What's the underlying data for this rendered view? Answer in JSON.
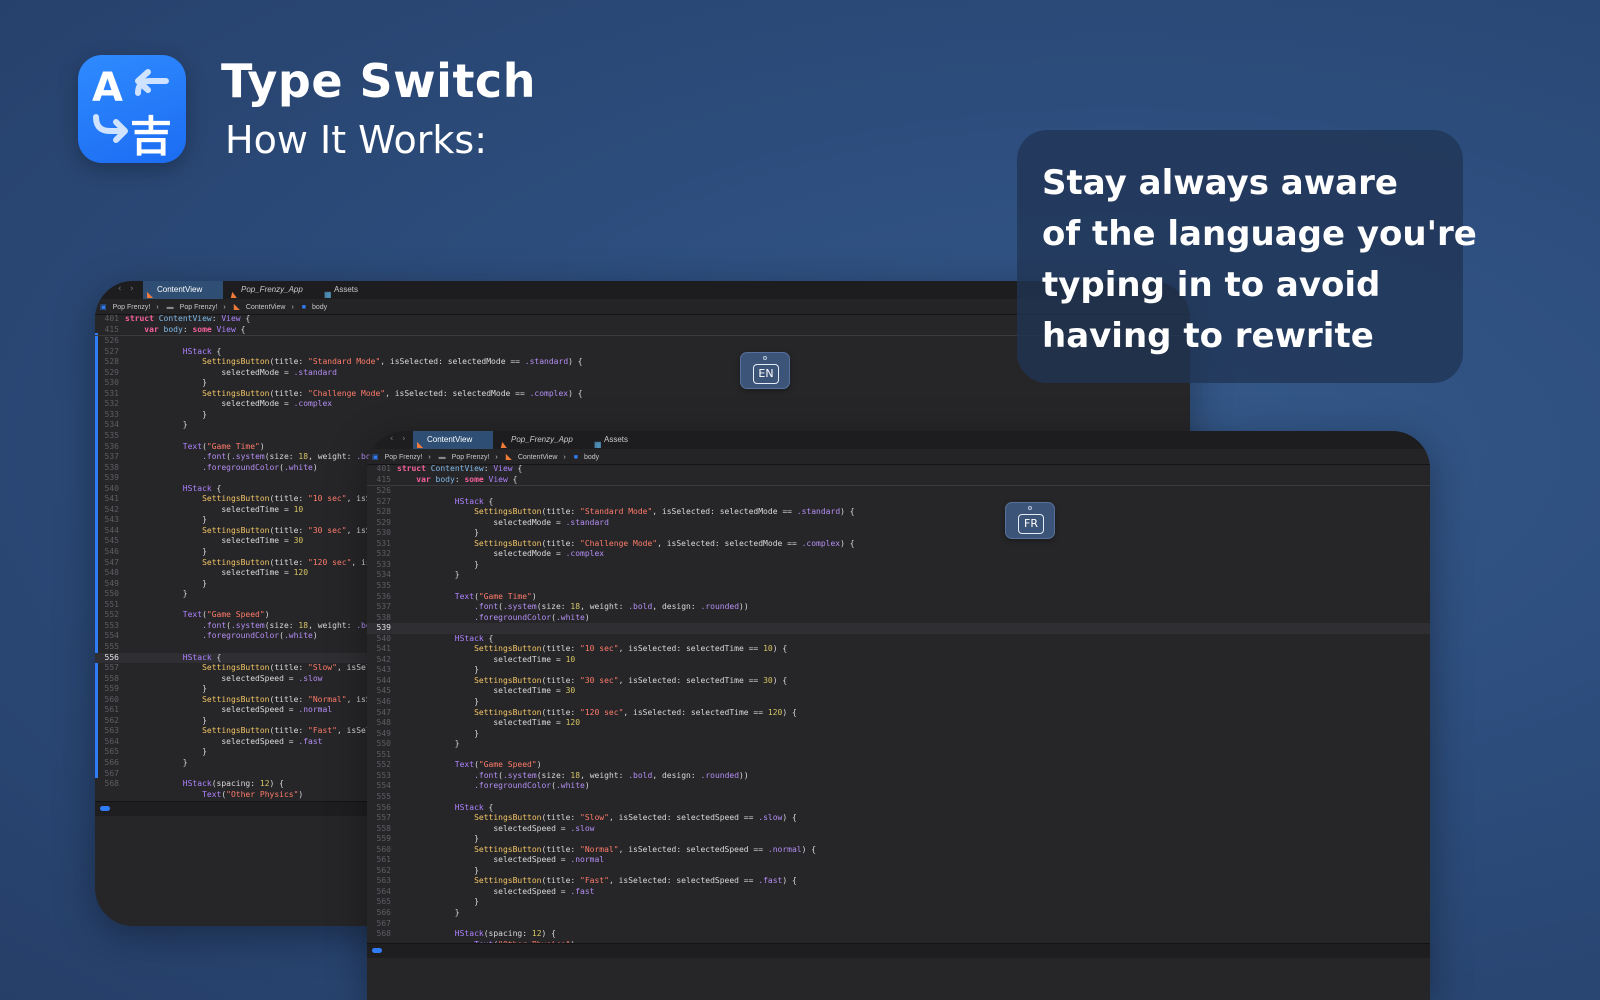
{
  "app": {
    "title": "Type Switch",
    "subtitle": "How It Works:",
    "icon": "translate-icon"
  },
  "callout": {
    "lines": [
      "Stay always aware",
      "of the language you're",
      "typing in to avoid",
      "having to rewrite"
    ]
  },
  "badges": {
    "back": "EN",
    "front": "FR"
  },
  "editor": {
    "tabs": [
      "ContentView",
      "Pop_Frenzy_App",
      "Assets"
    ],
    "breadcrumbs": [
      "Pop Frenzy!",
      "Pop Frenzy!",
      "ContentView",
      "body"
    ],
    "header_lines": [
      {
        "num": "401",
        "html": "<span class=\"kw\">struct</span> <span class=\"fn\">ContentView</span><span class=\"pl\">: </span><span class=\"ty\">View</span><span class=\"pl\"> {</span>"
      },
      {
        "num": "415",
        "html": "    <span class=\"kw\">var</span> <span class=\"fn\">body</span><span class=\"pl\">: </span><span class=\"kw\">some</span> <span class=\"ty\">View</span><span class=\"pl\"> {</span>"
      }
    ],
    "lines": [
      {
        "num": "526",
        "html": ""
      },
      {
        "num": "527",
        "html": "            <span class=\"ty\">HStack</span><span class=\"pl\"> {</span>"
      },
      {
        "num": "528",
        "html": "                <span class=\"cl\">SettingsButton</span><span class=\"pl\">(title: </span><span class=\"st\">\"Standard Mode\"</span><span class=\"pl\">, isSelected: selectedMode == </span><span class=\"pr\">.standard</span><span class=\"pl\">) {</span>"
      },
      {
        "num": "529",
        "html": "                    <span class=\"pl\">selectedMode = </span><span class=\"pr\">.standard</span>"
      },
      {
        "num": "530",
        "html": "                <span class=\"pl\">}</span>"
      },
      {
        "num": "531",
        "html": "                <span class=\"cl\">SettingsButton</span><span class=\"pl\">(title: </span><span class=\"st\">\"Challenge Mode\"</span><span class=\"pl\">, isSelected: selectedMode == </span><span class=\"pr\">.complex</span><span class=\"pl\">) {</span>"
      },
      {
        "num": "532",
        "html": "                    <span class=\"pl\">selectedMode = </span><span class=\"pr\">.complex</span>"
      },
      {
        "num": "533",
        "html": "                <span class=\"pl\">}</span>"
      },
      {
        "num": "534",
        "html": "            <span class=\"pl\">}</span>"
      },
      {
        "num": "535",
        "html": ""
      },
      {
        "num": "536",
        "html": "            <span class=\"ty\">Text</span><span class=\"pl\">(</span><span class=\"st\">\"Game Time\"</span><span class=\"pl\">)</span>"
      },
      {
        "num": "537",
        "html": "                <span class=\"pr\">.font</span><span class=\"pl\">(</span><span class=\"pr\">.system</span><span class=\"pl\">(size: </span><span class=\"nu\">18</span><span class=\"pl\">, weight: </span><span class=\"pr\">.bold</span><span class=\"pl\">, design: </span><span class=\"pr\">.rounded</span><span class=\"pl\">))</span>"
      },
      {
        "num": "538",
        "html": "                <span class=\"pr\">.foregroundColor</span><span class=\"pl\">(</span><span class=\"pr\">.white</span><span class=\"pl\">)</span>"
      },
      {
        "num": "539",
        "html": ""
      },
      {
        "num": "540",
        "html": "            <span class=\"ty\">HStack</span><span class=\"pl\"> {</span>"
      },
      {
        "num": "541",
        "html": "                <span class=\"cl\">SettingsButton</span><span class=\"pl\">(title: </span><span class=\"st\">\"10 sec\"</span><span class=\"pl\">, isSelected: selectedTime == </span><span class=\"nu\">10</span><span class=\"pl\">) {</span>"
      },
      {
        "num": "542",
        "html": "                    <span class=\"pl\">selectedTime = </span><span class=\"nu\">10</span>"
      },
      {
        "num": "543",
        "html": "                <span class=\"pl\">}</span>"
      },
      {
        "num": "544",
        "html": "                <span class=\"cl\">SettingsButton</span><span class=\"pl\">(title: </span><span class=\"st\">\"30 sec\"</span><span class=\"pl\">, isSelected: selectedTime == </span><span class=\"nu\">30</span><span class=\"pl\">) {</span>"
      },
      {
        "num": "545",
        "html": "                    <span class=\"pl\">selectedTime = </span><span class=\"nu\">30</span>"
      },
      {
        "num": "546",
        "html": "                <span class=\"pl\">}</span>"
      },
      {
        "num": "547",
        "html": "                <span class=\"cl\">SettingsButton</span><span class=\"pl\">(title: </span><span class=\"st\">\"120 sec\"</span><span class=\"pl\">, isSelected: selectedTime == </span><span class=\"nu\">120</span><span class=\"pl\">) {</span>"
      },
      {
        "num": "548",
        "html": "                    <span class=\"pl\">selectedTime = </span><span class=\"nu\">120</span>"
      },
      {
        "num": "549",
        "html": "                <span class=\"pl\">}</span>"
      },
      {
        "num": "550",
        "html": "            <span class=\"pl\">}</span>"
      },
      {
        "num": "551",
        "html": ""
      },
      {
        "num": "552",
        "html": "            <span class=\"ty\">Text</span><span class=\"pl\">(</span><span class=\"st\">\"Game Speed\"</span><span class=\"pl\">)</span>"
      },
      {
        "num": "553",
        "html": "                <span class=\"pr\">.font</span><span class=\"pl\">(</span><span class=\"pr\">.system</span><span class=\"pl\">(size: </span><span class=\"nu\">18</span><span class=\"pl\">, weight: </span><span class=\"pr\">.bold</span><span class=\"pl\">, design: </span><span class=\"pr\">.rounded</span><span class=\"pl\">))</span>"
      },
      {
        "num": "554",
        "html": "                <span class=\"pr\">.foregroundColor</span><span class=\"pl\">(</span><span class=\"pr\">.white</span><span class=\"pl\">)</span>"
      },
      {
        "num": "555",
        "html": ""
      },
      {
        "num": "556",
        "html": "            <span class=\"ty\">HStack</span><span class=\"pl\"> {</span>"
      },
      {
        "num": "557",
        "html": "                <span class=\"cl\">SettingsButton</span><span class=\"pl\">(title: </span><span class=\"st\">\"Slow\"</span><span class=\"pl\">, isSelected: selectedSpeed == </span><span class=\"pr\">.slow</span><span class=\"pl\">) {</span>"
      },
      {
        "num": "558",
        "html": "                    <span class=\"pl\">selectedSpeed = </span><span class=\"pr\">.slow</span>"
      },
      {
        "num": "559",
        "html": "                <span class=\"pl\">}</span>"
      },
      {
        "num": "560",
        "html": "                <span class=\"cl\">SettingsButton</span><span class=\"pl\">(title: </span><span class=\"st\">\"Normal\"</span><span class=\"pl\">, isSelected: selectedSpeed == </span><span class=\"pr\">.normal</span><span class=\"pl\">) {</span>"
      },
      {
        "num": "561",
        "html": "                    <span class=\"pl\">selectedSpeed = </span><span class=\"pr\">.normal</span>"
      },
      {
        "num": "562",
        "html": "                <span class=\"pl\">}</span>"
      },
      {
        "num": "563",
        "html": "                <span class=\"cl\">SettingsButton</span><span class=\"pl\">(title: </span><span class=\"st\">\"Fast\"</span><span class=\"pl\">, isSelected: selectedSpeed == </span><span class=\"pr\">.fast</span><span class=\"pl\">) {</span>"
      },
      {
        "num": "564",
        "html": "                    <span class=\"pl\">selectedSpeed = </span><span class=\"pr\">.fast</span>"
      },
      {
        "num": "565",
        "html": "                <span class=\"pl\">}</span>"
      },
      {
        "num": "566",
        "html": "            <span class=\"pl\">}</span>"
      },
      {
        "num": "567",
        "html": ""
      },
      {
        "num": "568",
        "html": "            <span class=\"ty\">HStack</span><span class=\"pl\">(spacing: </span><span class=\"nu\">12</span><span class=\"pl\">) {</span>"
      },
      {
        "num": "",
        "html": "                <span class=\"ty\">Text</span><span class=\"pl\">(</span><span class=\"st\">\"Other Physics\"</span><span class=\"pl\">)</span>"
      }
    ],
    "back_current_line": "556",
    "front_current_line": "539"
  },
  "colors": {
    "accent": "#2f7cf6",
    "background": "#2d4e7e",
    "editor_bg": "#262628"
  }
}
